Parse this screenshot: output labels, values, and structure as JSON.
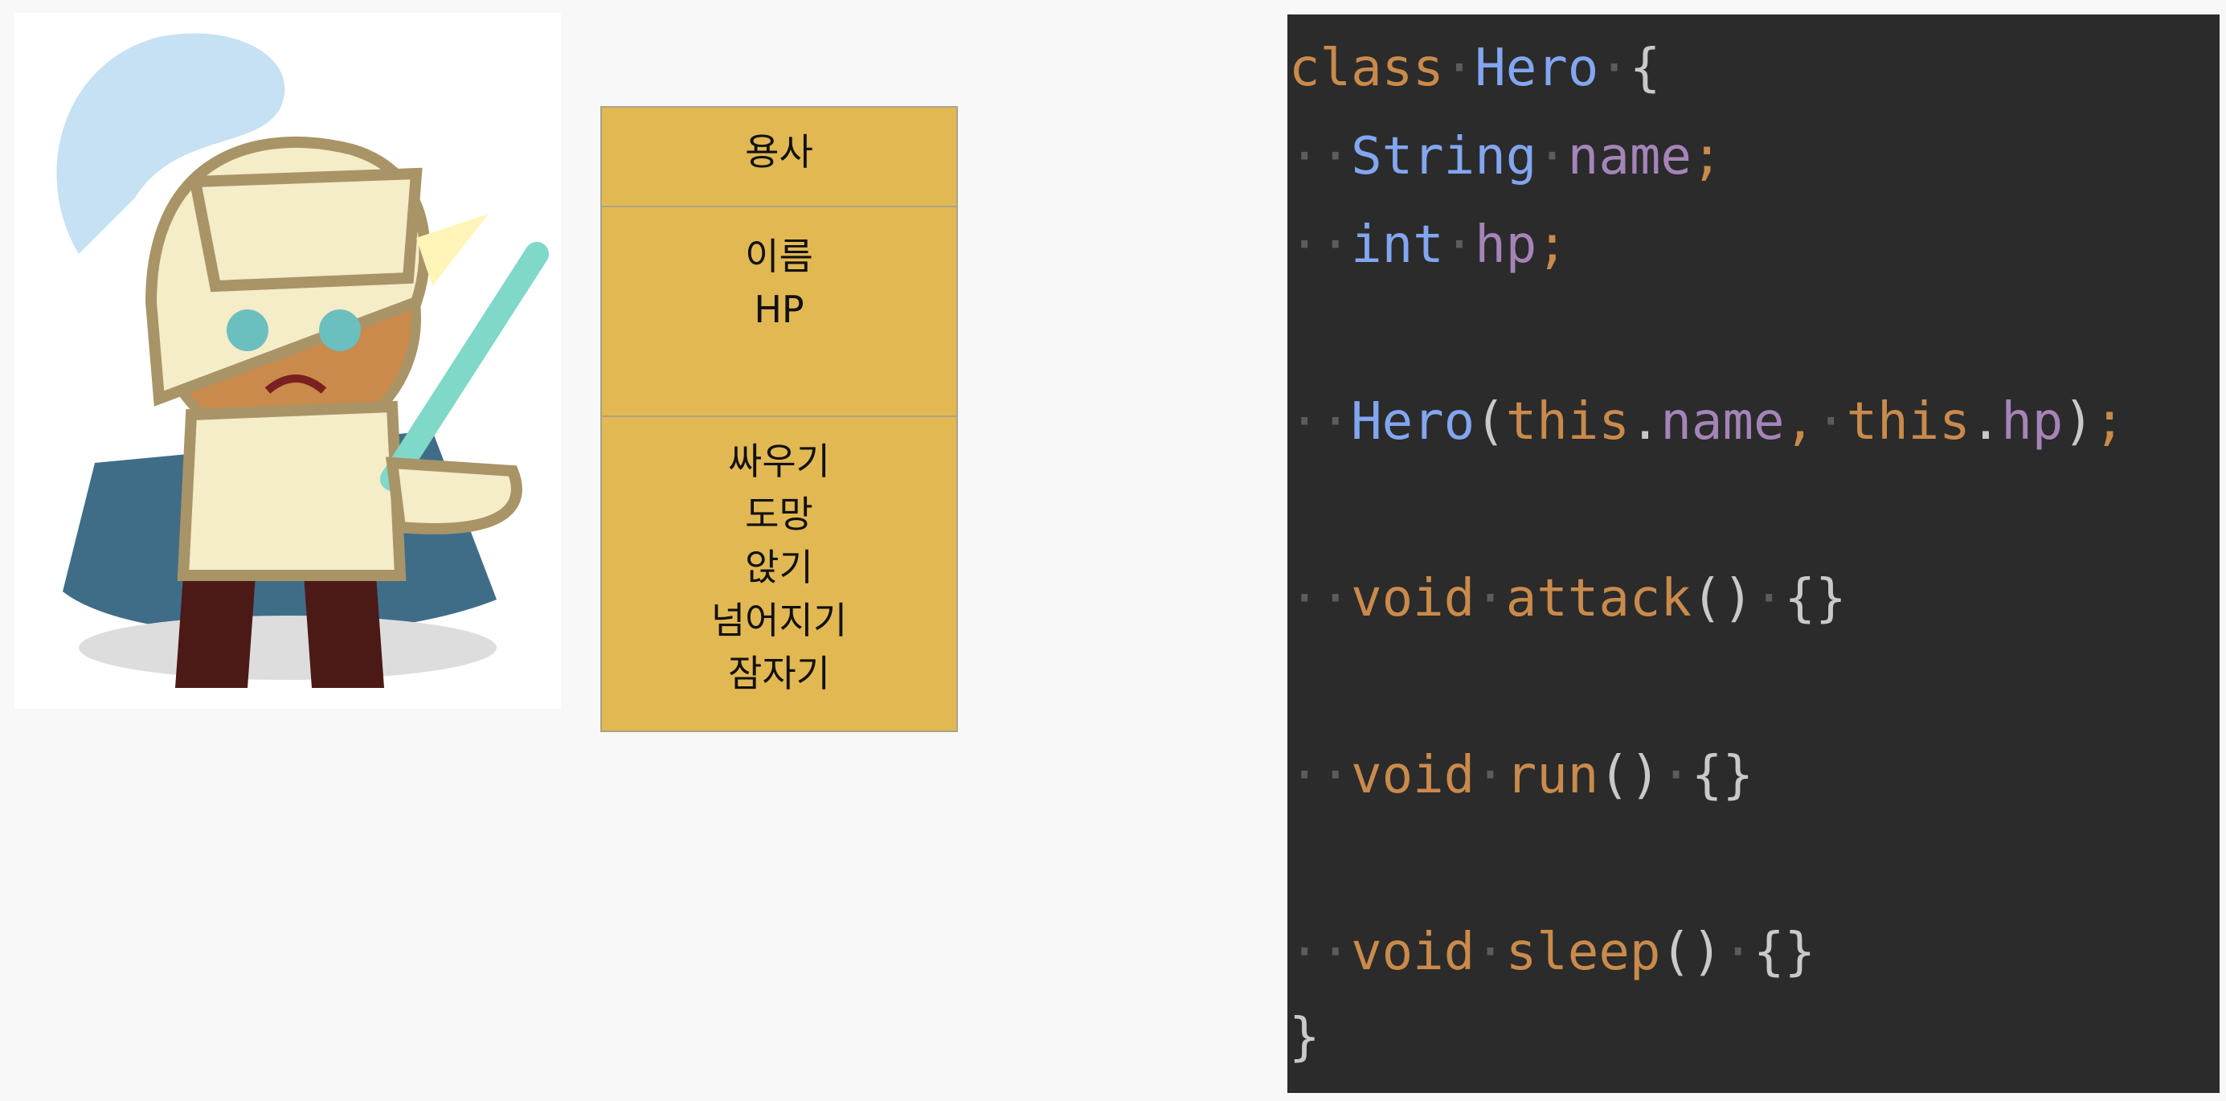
{
  "uml": {
    "class_name": "용사",
    "attributes": [
      "이름",
      "HP"
    ],
    "operations": [
      "싸우기",
      "도망",
      "앉기",
      "넘어지기",
      "잠자기"
    ]
  },
  "colors": {
    "uml_fill": "#e2b853",
    "code_bg": "#2b2b2b",
    "keyword": "#c98a4b",
    "type": "#82a6f0",
    "variable": "#a584b8"
  },
  "code": {
    "lines": [
      [
        [
          "kw",
          "class"
        ],
        [
          "ws",
          "·"
        ],
        [
          "ty",
          "Hero"
        ],
        [
          "ws",
          "·"
        ],
        [
          "pn",
          "{"
        ]
      ],
      [
        [
          "ws",
          "··"
        ],
        [
          "ty",
          "String"
        ],
        [
          "ws",
          "·"
        ],
        [
          "var",
          "name"
        ],
        [
          "semi",
          ";"
        ]
      ],
      [
        [
          "ws",
          "··"
        ],
        [
          "ty",
          "int"
        ],
        [
          "ws",
          "·"
        ],
        [
          "var",
          "hp"
        ],
        [
          "semi",
          ";"
        ]
      ],
      [
        [
          "ws",
          "··"
        ],
        [
          "ty",
          "Hero"
        ],
        [
          "pn",
          "("
        ],
        [
          "kw",
          "this"
        ],
        [
          "pn",
          "."
        ],
        [
          "var",
          "name"
        ],
        [
          "semi",
          ","
        ],
        [
          "ws",
          "·"
        ],
        [
          "kw",
          "this"
        ],
        [
          "pn",
          "."
        ],
        [
          "var",
          "hp"
        ],
        [
          "pn",
          ")"
        ],
        [
          "semi",
          ";"
        ]
      ],
      [
        [
          "ws",
          "··"
        ],
        [
          "kw",
          "void"
        ],
        [
          "ws",
          "·"
        ],
        [
          "kw",
          "attack"
        ],
        [
          "pn",
          "()"
        ],
        [
          "ws",
          "·"
        ],
        [
          "pn",
          "{}"
        ]
      ],
      [
        [
          "ws",
          "··"
        ],
        [
          "kw",
          "void"
        ],
        [
          "ws",
          "·"
        ],
        [
          "kw",
          "run"
        ],
        [
          "pn",
          "()"
        ],
        [
          "ws",
          "·"
        ],
        [
          "pn",
          "{}"
        ]
      ],
      [
        [
          "ws",
          "··"
        ],
        [
          "kw",
          "void"
        ],
        [
          "ws",
          "·"
        ],
        [
          "kw",
          "sleep"
        ],
        [
          "pn",
          "()"
        ],
        [
          "ws",
          "·"
        ],
        [
          "pn",
          "{}"
        ]
      ],
      [
        [
          "pn",
          "}"
        ]
      ]
    ]
  }
}
